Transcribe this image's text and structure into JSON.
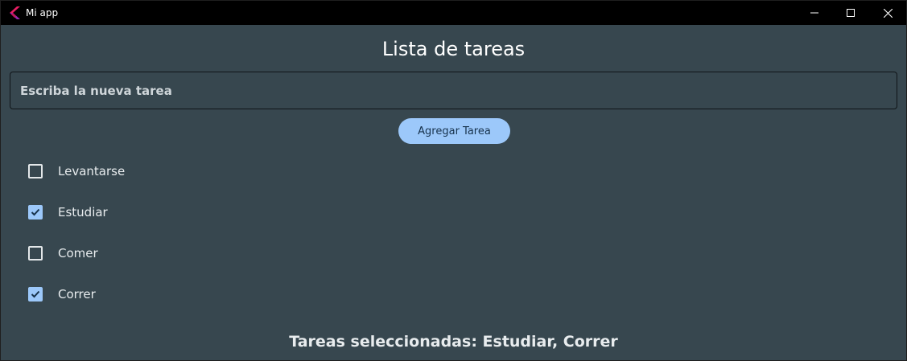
{
  "window": {
    "title": "Mi app"
  },
  "page": {
    "title": "Lista de tareas"
  },
  "new_task": {
    "placeholder": "Escriba la nueva tarea",
    "value": ""
  },
  "add_button": {
    "label": "Agregar Tarea"
  },
  "tasks": [
    {
      "label": "Levantarse",
      "checked": false
    },
    {
      "label": "Estudiar",
      "checked": true
    },
    {
      "label": "Comer",
      "checked": false
    },
    {
      "label": "Correr",
      "checked": true
    }
  ],
  "summary": {
    "text": "Tareas seleccionadas: Estudiar, Correr"
  },
  "colors": {
    "background": "#37474f",
    "titlebar": "#000000",
    "accent": "#9cc8fa"
  },
  "icons": {
    "app": "flutter-logo-icon",
    "minimize": "minimize-icon",
    "maximize": "maximize-icon",
    "close": "close-icon",
    "check": "checkmark-icon"
  }
}
